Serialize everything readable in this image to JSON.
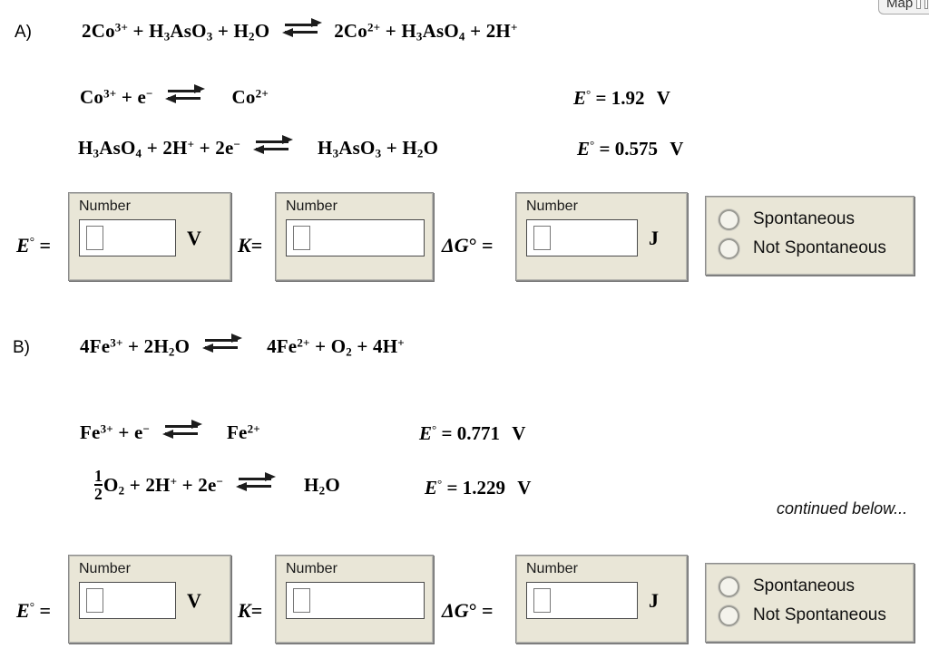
{
  "top_bar": {
    "map_button_label": "Map",
    "map_icon": "map-pages-icon"
  },
  "sections": [
    {
      "label": "A)",
      "overall_reaction": {
        "left": "2Co3+ + H3AsO3 + H2O",
        "right": "2Co2+ + H3AsO4 + 2H+"
      },
      "half_reactions": [
        {
          "left": "Co3+ + e−",
          "right": "Co2+",
          "e_symbol": "E",
          "e_degree": "°",
          "equals": "=",
          "e_value": "1.92",
          "e_unit": "V"
        },
        {
          "left": "H3AsO4 + 2H+ + 2e−",
          "right": "H3AsO3 + H2O",
          "e_symbol": "E",
          "e_degree": "°",
          "equals": "=",
          "e_value": "0.575",
          "e_unit": "V"
        }
      ],
      "answers": {
        "e_cell": {
          "prefix_symbol": "E",
          "prefix_degree": "°",
          "prefix_equals": "=",
          "field_label": "Number",
          "value": "",
          "unit": "V"
        },
        "k": {
          "prefix_symbol": "K",
          "prefix_degree": "",
          "prefix_equals": "=",
          "field_label": "Number",
          "value": "",
          "unit": ""
        },
        "delta_g": {
          "prefix_symbol": "ΔG",
          "prefix_degree": "°",
          "prefix_equals": "=",
          "field_label": "Number",
          "value": "",
          "unit": "J"
        },
        "spontaneity": {
          "options": [
            "Spontaneous",
            "Not Spontaneous"
          ],
          "selected": ""
        }
      }
    },
    {
      "label": "B)",
      "overall_reaction": {
        "left": "4Fe3+ + 2H2O",
        "right": "4Fe2+ + O2 + 4H+"
      },
      "half_reactions": [
        {
          "left": "Fe3+ + e−",
          "right": "Fe2+",
          "e_symbol": "E",
          "e_degree": "°",
          "equals": "=",
          "e_value": "0.771",
          "e_unit": "V"
        },
        {
          "left": "1/2 O2 + 2H+ + 2e−",
          "right": "H2O",
          "e_symbol": "E",
          "e_degree": "°",
          "equals": "=",
          "e_value": "1.229",
          "e_unit": "V"
        }
      ],
      "answers": {
        "e_cell": {
          "prefix_symbol": "E",
          "prefix_degree": "°",
          "prefix_equals": "=",
          "field_label": "Number",
          "value": "",
          "unit": "V"
        },
        "k": {
          "prefix_symbol": "K",
          "prefix_degree": "",
          "prefix_equals": "=",
          "field_label": "Number",
          "value": "",
          "unit": ""
        },
        "delta_g": {
          "prefix_symbol": "ΔG",
          "prefix_degree": "°",
          "prefix_equals": "=",
          "field_label": "Number",
          "value": "",
          "unit": "J"
        },
        "spontaneity": {
          "options": [
            "Spontaneous",
            "Not Spontaneous"
          ],
          "selected": ""
        }
      }
    }
  ],
  "notes": {
    "continued": "continued below..."
  },
  "formula_parts": {
    "a_overall_left": {
      "c1": "2Co",
      "s1": "3+",
      "p1": " + H",
      "sub1": "3",
      "p2": "AsO",
      "sub2": "3",
      "p3": " + H",
      "sub3": "2",
      "p4": "O"
    },
    "a_overall_right": {
      "c1": "2Co",
      "s1": "2+",
      "p1": " + H",
      "sub1": "3",
      "p2": "AsO",
      "sub2": "4",
      "p3": " + 2H",
      "s2": "+"
    },
    "a_half1_left": {
      "c1": "Co",
      "s1": "3+",
      "p1": " + e",
      "s2": "−"
    },
    "a_half1_right": {
      "c1": "Co",
      "s1": "2+"
    },
    "a_half2_left": {
      "c1": "H",
      "sub1": "3",
      "p1": "AsO",
      "sub2": "4",
      "p2": " + 2H",
      "s1": "+",
      "p3": " + 2e",
      "s2": "−"
    },
    "a_half2_right": {
      "c1": "H",
      "sub1": "3",
      "p1": "AsO",
      "sub2": "3",
      "p2": " + H",
      "sub3": "2",
      "p3": "O"
    },
    "b_overall_left": {
      "c1": "4Fe",
      "s1": "3+",
      "p1": " + 2H",
      "sub1": "2",
      "p2": "O"
    },
    "b_overall_right": {
      "c1": "4Fe",
      "s1": "2+",
      "p1": " + O",
      "sub1": "2",
      "p2": " + 4H",
      "s2": "+"
    },
    "b_half1_left": {
      "c1": "Fe",
      "s1": "3+",
      "p1": " + e",
      "s2": "−"
    },
    "b_half1_right": {
      "c1": "Fe",
      "s1": "2+"
    },
    "b_half2_num": "1",
    "b_half2_den": "2",
    "b_half2_left": {
      "c1": "O",
      "sub1": "2",
      "p1": " + 2H",
      "s1": "+",
      "p2": " + 2e",
      "s2": "−"
    },
    "b_half2_right": {
      "c1": "H",
      "sub1": "2",
      "p1": "O"
    }
  }
}
